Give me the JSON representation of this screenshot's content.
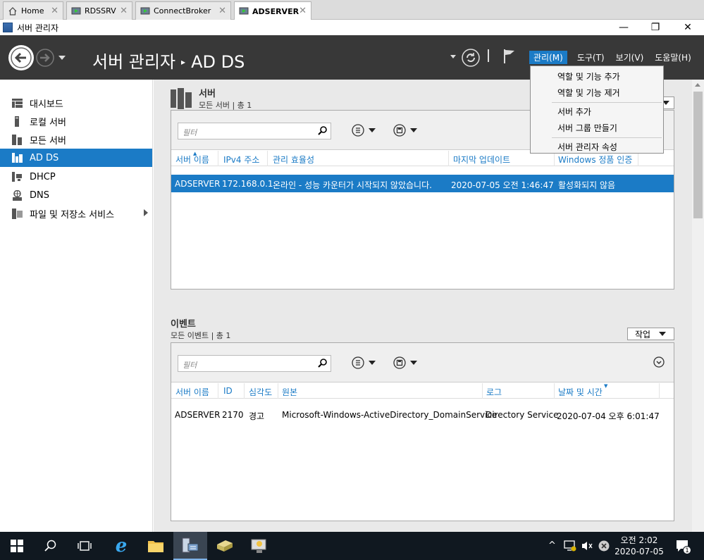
{
  "tabs": [
    {
      "label": "Home"
    },
    {
      "label": "RDSSRV"
    },
    {
      "label": "ConnectBroker"
    },
    {
      "label": "ADSERVER"
    }
  ],
  "window": {
    "title": "서버 관리자"
  },
  "header": {
    "breadcrumb_root": "서버 관리자",
    "breadcrumb_current": "AD DS",
    "menus": [
      "관리(M)",
      "도구(T)",
      "보기(V)",
      "도움말(H)"
    ]
  },
  "manage_menu": {
    "items": [
      "역할 및 기능 추가",
      "역할 및 기능 제거",
      "서버 추가",
      "서버 그룹 만들기",
      "서버 관리자 속성"
    ]
  },
  "sidebar": {
    "items": [
      {
        "label": "대시보드",
        "icon": "dashboard-icon"
      },
      {
        "label": "로컬 서버",
        "icon": "local-server-icon"
      },
      {
        "label": "모든 서버",
        "icon": "all-servers-icon"
      },
      {
        "label": "AD DS",
        "icon": "ad-ds-icon"
      },
      {
        "label": "DHCP",
        "icon": "dhcp-icon"
      },
      {
        "label": "DNS",
        "icon": "dns-icon"
      },
      {
        "label": "파일 및 저장소 서비스",
        "icon": "file-storage-icon"
      }
    ]
  },
  "servers": {
    "title": "서버",
    "subtitle": "모든 서버 | 총 1",
    "filter_placeholder": "필터",
    "columns": [
      "서버 이름",
      "IPv4 주소",
      "관리 효율성",
      "마지막 업데이트",
      "Windows 정품 인증"
    ],
    "rows": [
      [
        "ADSERVER",
        "172.168.0.1",
        "온라인 - 성능 카운터가 시작되지 않았습니다.",
        "2020-07-05 오전 1:46:47",
        "활성화되지 않음"
      ]
    ]
  },
  "events": {
    "title": "이벤트",
    "subtitle": "모든 이벤트 | 총 1",
    "tasks_label": "작업",
    "filter_placeholder": "필터",
    "columns": [
      "서버 이름",
      "ID",
      "심각도",
      "원본",
      "로그",
      "날짜 및 시간"
    ],
    "rows": [
      [
        "ADSERVER",
        "2170",
        "경고",
        "Microsoft-Windows-ActiveDirectory_DomainService",
        "Directory Service",
        "2020-07-04 오후 6:01:47"
      ]
    ]
  },
  "taskbar": {
    "time": "오전 2:02",
    "date": "2020-07-05",
    "notifications": "1"
  },
  "colors": {
    "accent": "#1b7bc6",
    "header_bg": "#383838",
    "taskbar_bg": "#101820"
  }
}
